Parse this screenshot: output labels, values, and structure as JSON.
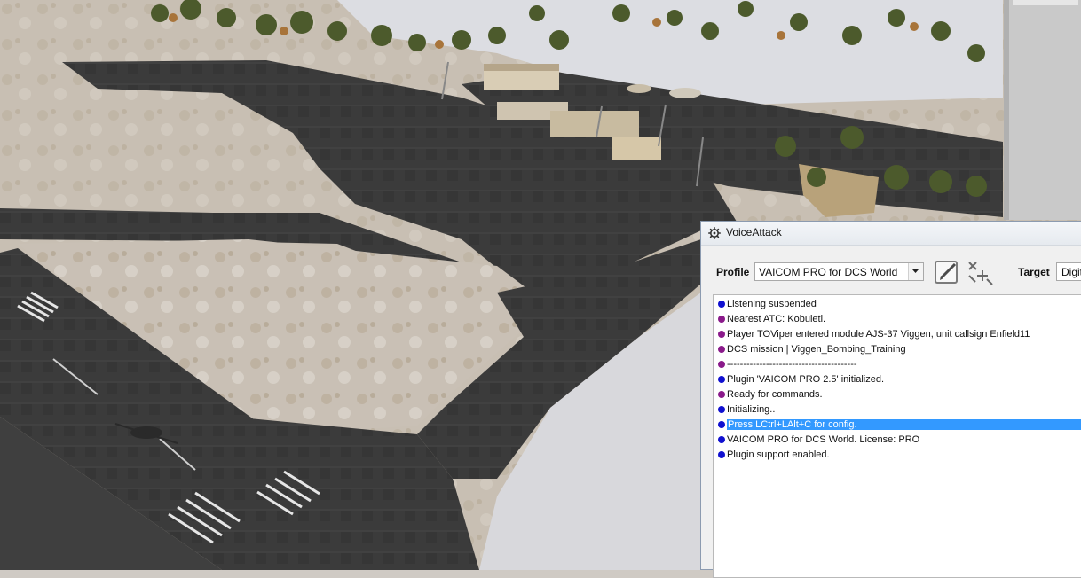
{
  "window": {
    "title": "VoiceAttack",
    "icon": "gear-icon"
  },
  "profile": {
    "label": "Profile",
    "selected": "VAICOM PRO for DCS World"
  },
  "target": {
    "label": "Target",
    "value": "Digit"
  },
  "toolbar": {
    "edit_icon": "edit-profile-icon",
    "add_icon": "add-profile-icon"
  },
  "colors": {
    "blue_dot": "#1010d0",
    "purple_dot": "#8a1a8a",
    "selection": "#3399ff"
  },
  "log": [
    {
      "text": "Listening suspended",
      "color": "blue"
    },
    {
      "text": "Nearest ATC: Kobuleti.",
      "color": "purple"
    },
    {
      "text": "Player TOViper entered module AJS-37 Viggen, unit callsign Enfield11",
      "color": "purple"
    },
    {
      "text": "DCS mission | Viggen_Bombing_Training",
      "color": "purple"
    },
    {
      "text": "----------------------------------------",
      "color": "purple"
    },
    {
      "text": "Plugin 'VAICOM PRO 2.5' initialized.",
      "color": "blue"
    },
    {
      "text": "Ready for commands.",
      "color": "purple"
    },
    {
      "text": "Initializing..",
      "color": "blue"
    },
    {
      "text": "Press LCtrl+LAlt+C for config.",
      "color": "blue",
      "selected": true
    },
    {
      "text": "VAICOM PRO for DCS World. License: PRO",
      "color": "blue"
    },
    {
      "text": "Plugin support enabled.",
      "color": "blue"
    }
  ]
}
